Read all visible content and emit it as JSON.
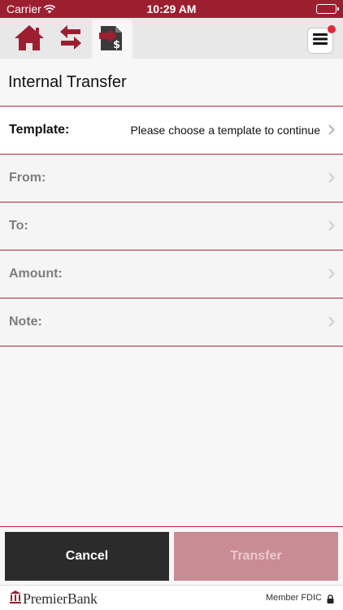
{
  "status_bar": {
    "carrier": "Carrier",
    "time": "10:29 AM"
  },
  "nav": {
    "icons": [
      "home-icon",
      "transfer-arrows-icon",
      "internal-transfer-icon",
      "hamburger-menu-icon"
    ],
    "has_notification": true
  },
  "page": {
    "title": "Internal Transfer"
  },
  "form": {
    "template_label": "Template:",
    "template_value": "Please choose a template to continue",
    "from_label": "From:",
    "to_label": "To:",
    "amount_label": "Amount:",
    "note_label": "Note:"
  },
  "actions": {
    "cancel_label": "Cancel",
    "transfer_label": "Transfer"
  },
  "footer": {
    "brand": "PremierBank",
    "member": "Member FDIC"
  },
  "colors": {
    "brand_red": "#9c1f30",
    "divider_red": "#b2273a",
    "cancel_bg": "#2b2b2b",
    "transfer_disabled_bg": "#c98b94"
  }
}
